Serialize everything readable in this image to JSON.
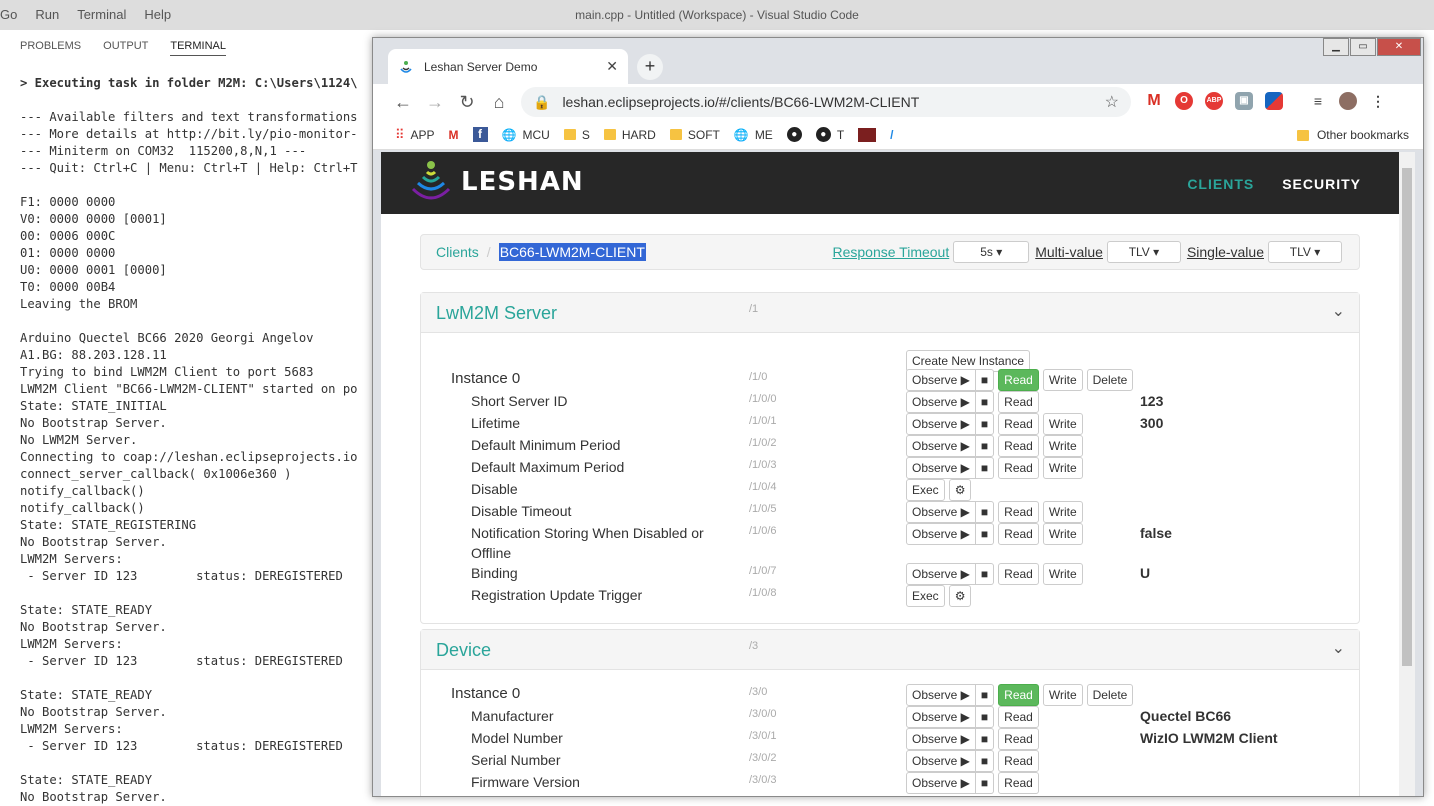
{
  "vscode": {
    "menu": [
      "Go",
      "Run",
      "Terminal",
      "Help"
    ],
    "title": "main.cpp - Untitled (Workspace) - Visual Studio Code",
    "panel_tabs": [
      "PROBLEMS",
      "OUTPUT",
      "TERMINAL"
    ],
    "terminal_lines": [
      "> Executing task in folder M2M: C:\\Users\\1124\\",
      "",
      "--- Available filters and text transformations",
      "--- More details at http://bit.ly/pio-monitor-",
      "--- Miniterm on COM32  115200,8,N,1 ---",
      "--- Quit: Ctrl+C | Menu: Ctrl+T | Help: Ctrl+T",
      "",
      "F1: 0000 0000",
      "V0: 0000 0000 [0001]",
      "00: 0006 000C",
      "01: 0000 0000",
      "U0: 0000 0001 [0000]",
      "T0: 0000 00B4",
      "Leaving the BROM",
      "",
      "Arduino Quectel BC66 2020 Georgi Angelov",
      "A1.BG: 88.203.128.11",
      "Trying to bind LWM2M Client to port 5683",
      "LWM2M Client \"BC66-LWM2M-CLIENT\" started on po",
      "State: STATE_INITIAL",
      "No Bootstrap Server.",
      "No LWM2M Server.",
      "Connecting to coap://leshan.eclipseprojects.io",
      "connect_server_callback( 0x1006e360 )",
      "notify_callback()",
      "notify_callback()",
      "State: STATE_REGISTERING",
      "No Bootstrap Server.",
      "LWM2M Servers:",
      " - Server ID 123        status: DEREGISTERED",
      "",
      "State: STATE_READY",
      "No Bootstrap Server.",
      "LWM2M Servers:",
      " - Server ID 123        status: DEREGISTERED",
      "",
      "State: STATE_READY",
      "No Bootstrap Server.",
      "LWM2M Servers:",
      " - Server ID 123        status: DEREGISTERED",
      "",
      "State: STATE_READY",
      "No Bootstrap Server."
    ]
  },
  "browser": {
    "tab_title": "Leshan Server Demo",
    "url": "leshan.eclipseprojects.io/#/clients/BC66-LWM2M-CLIENT",
    "bookmarks": [
      {
        "label": "APP",
        "icon": "apps-grid-icon"
      },
      {
        "label": "",
        "icon": "gmail-icon"
      },
      {
        "label": "",
        "icon": "facebook-icon"
      },
      {
        "label": "MCU",
        "icon": "globe-icon"
      },
      {
        "label": "S",
        "icon": "folder-icon"
      },
      {
        "label": "HARD",
        "icon": "folder-icon"
      },
      {
        "label": "SOFT",
        "icon": "folder-icon"
      },
      {
        "label": "ME",
        "icon": "globe-icon"
      },
      {
        "label": "",
        "icon": "github-icon"
      },
      {
        "label": "T",
        "icon": "github-icon"
      },
      {
        "label": "",
        "icon": "rock-icon"
      },
      {
        "label": "",
        "icon": "slash-icon"
      }
    ],
    "other_bookmarks": "Other bookmarks"
  },
  "leshan": {
    "logo": "LESHAN",
    "nav": {
      "clients": "CLIENTS",
      "security": "SECURITY"
    },
    "breadcrumb": {
      "root": "Clients",
      "current": "BC66-LWM2M-CLIENT"
    },
    "options": {
      "response_timeout_label": "Response Timeout",
      "response_timeout_value": "5s",
      "multi_value_label": "Multi-value",
      "multi_value_value": "TLV",
      "single_value_label": "Single-value",
      "single_value_value": "TLV"
    },
    "labels": {
      "observe": "Observe ▶",
      "stop": "■",
      "read": "Read",
      "write": "Write",
      "delete": "Delete",
      "exec": "Exec",
      "create_instance": "Create New Instance"
    },
    "server_object": {
      "title": "LwM2M Server",
      "path": "/1",
      "instance": {
        "name": "Instance 0",
        "path": "/1/0"
      },
      "resources": [
        {
          "name": "Short Server ID",
          "path": "/1/0/0",
          "value": "123"
        },
        {
          "name": "Lifetime",
          "path": "/1/0/1",
          "value": "300"
        },
        {
          "name": "Default Minimum Period",
          "path": "/1/0/2",
          "value": ""
        },
        {
          "name": "Default Maximum Period",
          "path": "/1/0/3",
          "value": ""
        },
        {
          "name": "Disable",
          "path": "/1/0/4",
          "value": ""
        },
        {
          "name": "Disable Timeout",
          "path": "/1/0/5",
          "value": ""
        },
        {
          "name": "Notification Storing When Disabled or",
          "name2": "Offline",
          "path": "/1/0/6",
          "value": "false"
        },
        {
          "name": "Binding",
          "path": "/1/0/7",
          "value": "U"
        },
        {
          "name": "Registration Update Trigger",
          "path": "/1/0/8",
          "value": ""
        }
      ]
    },
    "device_object": {
      "title": "Device",
      "path": "/3",
      "instance": {
        "name": "Instance 0",
        "path": "/3/0"
      },
      "resources": [
        {
          "name": "Manufacturer",
          "path": "/3/0/0",
          "value": "Quectel BC66"
        },
        {
          "name": "Model Number",
          "path": "/3/0/1",
          "value": "WizIO LWM2M Client"
        },
        {
          "name": "Serial Number",
          "path": "/3/0/2",
          "value": ""
        },
        {
          "name": "Firmware Version",
          "path": "/3/0/3",
          "value": ""
        }
      ]
    }
  }
}
